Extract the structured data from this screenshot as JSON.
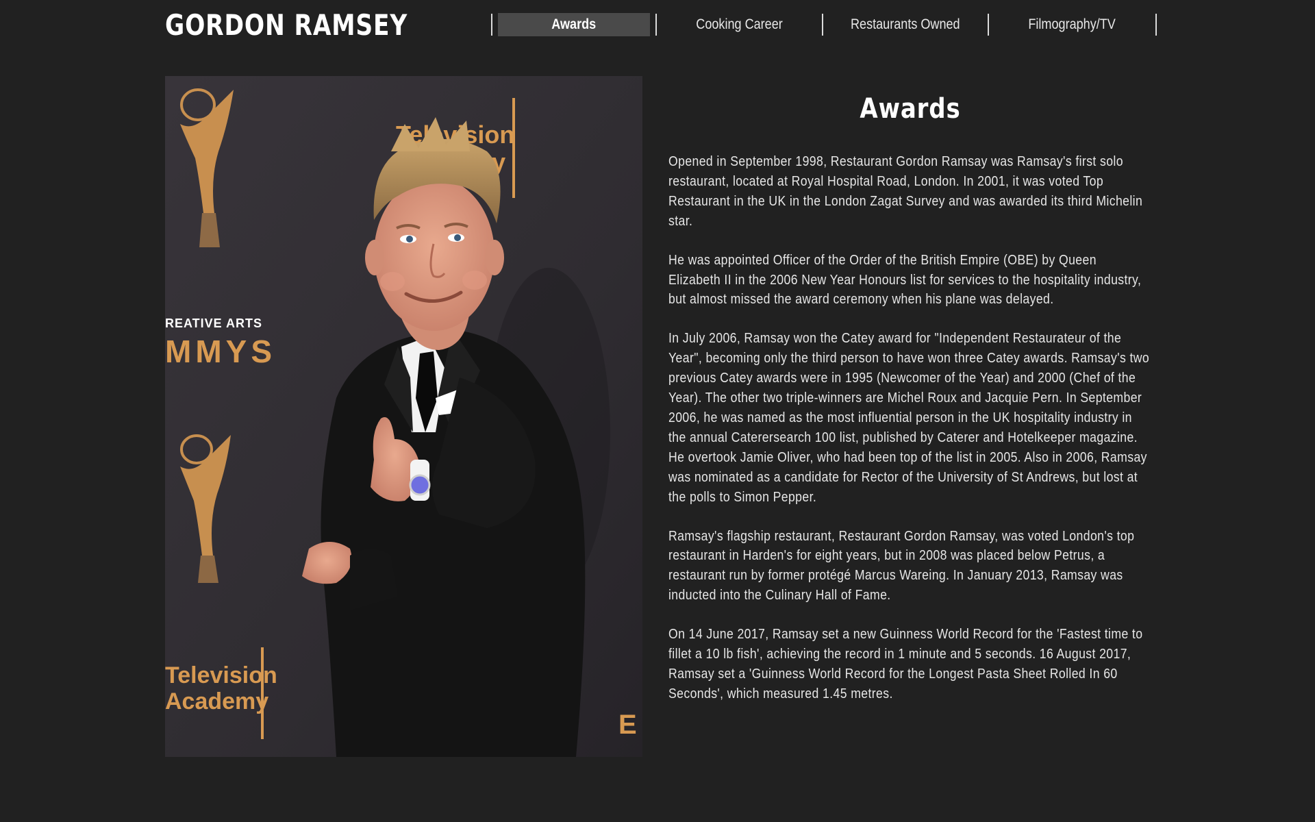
{
  "site": {
    "title": "GORDON RAMSEY"
  },
  "nav": {
    "items": [
      {
        "label": "Awards",
        "active": true
      },
      {
        "label": "Cooking Career",
        "active": false
      },
      {
        "label": "Restaurants Owned",
        "active": false
      },
      {
        "label": "Filmography/TV",
        "active": false
      }
    ]
  },
  "hero": {
    "photo_icon": "portrait-photo",
    "backdrop_text": {
      "television_academy": "Television\nAcademy",
      "creative_arts": "REATIVE ARTS",
      "emmys": "MMYS"
    }
  },
  "main": {
    "title": "Awards",
    "paragraphs": [
      "Opened in September 1998, Restaurant Gordon Ramsay was Ramsay's first solo restaurant, located at Royal Hospital Road, London. In 2001, it was voted Top Restaurant in the UK in the London Zagat Survey and was awarded its third Michelin star.",
      "He was appointed Officer of the Order of the British Empire (OBE) by Queen Elizabeth II in the 2006 New Year Honours list for services to the hospitality industry, but almost missed the award ceremony when his plane was delayed.",
      "In July 2006, Ramsay won the Catey award for \"Independent Restaurateur of the Year\", becoming only the third person to have won three Catey awards. Ramsay's two previous Catey awards were in 1995 (Newcomer of the Year) and 2000 (Chef of the Year). The other two triple-winners are Michel Roux and Jacquie Pern. In September 2006, he was named as the most influential person in the UK hospitality industry in the annual Caterersearch 100 list, published by Caterer and Hotelkeeper magazine. He overtook Jamie Oliver, who had been top of the list in 2005. Also in 2006, Ramsay was nominated as a candidate for Rector of the University of St Andrews, but lost at the polls to Simon Pepper.",
      "Ramsay's flagship restaurant, Restaurant Gordon Ramsay, was voted London's top restaurant in Harden's for eight years, but in 2008 was placed below Petrus, a restaurant run by former protégé Marcus Wareing. In January 2013, Ramsay was inducted into the Culinary Hall of Fame.",
      "On 14 June 2017, Ramsay set a new Guinness World Record for the 'Fastest time to fillet a 10 lb fish', achieving the record in 1 minute and 5 seconds. 16 August 2017, Ramsay set a 'Guinness World Record for the Longest Pasta Sheet Rolled In 60 Seconds', which measured 1.45 metres."
    ]
  },
  "colors": {
    "background": "#212121",
    "nav_active_bg": "#4a4a4a",
    "text": "#e6e6e6",
    "emmy_gold": "#d89a52"
  }
}
